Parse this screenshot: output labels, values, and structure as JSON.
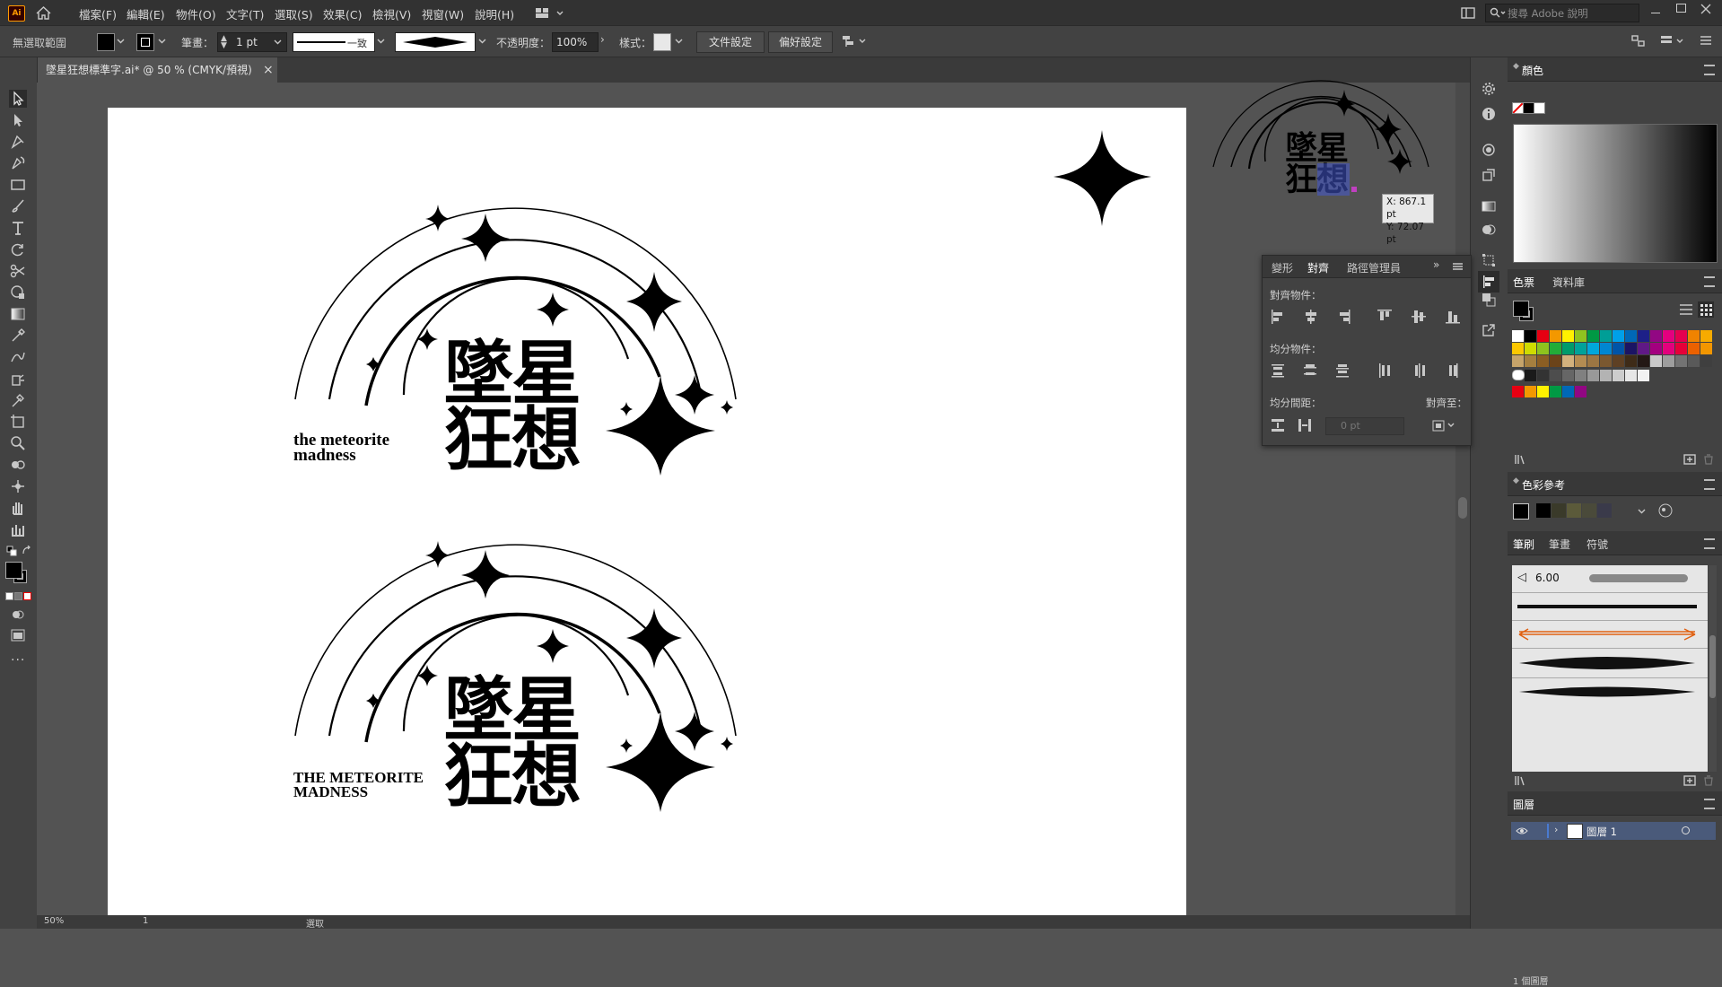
{
  "app": {
    "logo": "Ai"
  },
  "menubar": {
    "items": [
      "檔案(F)",
      "編輯(E)",
      "物件(O)",
      "文字(T)",
      "選取(S)",
      "效果(C)",
      "檢視(V)",
      "視窗(W)",
      "說明(H)"
    ],
    "search_placeholder": "搜尋 Adobe 說明"
  },
  "controlbar": {
    "selection_label": "無選取範圍",
    "stroke_label": "筆畫：",
    "stroke_value": "1 pt",
    "profile_label": "一致",
    "opacity_label": "不透明度：",
    "opacity_value": "100%",
    "style_label": "樣式：",
    "doc_setup": "文件設定",
    "preferences": "偏好設定"
  },
  "document": {
    "tab_title": "墜星狂想標準字.ai* @ 50 % (CMYK/預視)",
    "close": "×"
  },
  "artwork": {
    "logo1_cjk_line1": "墜星",
    "logo1_cjk_line2": "狂想",
    "logo1_en_line1": "the meteorite",
    "logo1_en_line2": "madness",
    "logo2_cjk_line1": "墜星",
    "logo2_cjk_line2": "狂想",
    "logo2_en_line1": "THE METEORITE",
    "logo2_en_line2": "MADNESS",
    "preview_line1": "墜星",
    "preview_line2": "狂想"
  },
  "tooltip": {
    "x": "X: 867.1 pt",
    "y": "Y: 72.07 pt"
  },
  "align_panel": {
    "tabs": [
      "變形",
      "對齊",
      "路徑管理員"
    ],
    "active_tab": "對齊",
    "align_objects": "對齊物件：",
    "distribute_objects": "均分物件：",
    "distribute_spacing": "均分間距：",
    "align_to": "對齊至：",
    "spacing_value": "0 pt"
  },
  "panels": {
    "color": {
      "title": "顏色"
    },
    "swatches": {
      "tabs": [
        "色票",
        "資料庫"
      ]
    },
    "color_guide": {
      "title": "色彩參考"
    },
    "brushes": {
      "tabs": [
        "筆刷",
        "筆畫",
        "符號"
      ],
      "size": "6.00"
    },
    "layers": {
      "title": "圖層",
      "layer_name": "圖層 1",
      "count": "1 個圖層"
    }
  },
  "status": {
    "zoom": "50%",
    "artboard": "1",
    "mode": "選取"
  },
  "colors": {
    "swatch_row1": [
      "#ffffff",
      "#000000",
      "#e60012",
      "#f39800",
      "#fff100",
      "#8fc31f",
      "#009944",
      "#009e96",
      "#00a0e9",
      "#0068b7",
      "#1d2088",
      "#920783",
      "#e4007f",
      "#e5004f",
      "#f08300",
      "#f6ab00"
    ],
    "swatch_row2": [
      "#fcc800",
      "#cfdb00",
      "#8ec31e",
      "#22ac38",
      "#009b6b",
      "#00a29a",
      "#00a7db",
      "#0086d1",
      "#0054a7",
      "#1b1464",
      "#601986",
      "#a3007f",
      "#e3007d",
      "#e60039",
      "#eb6100",
      "#f29600"
    ],
    "swatch_row3": [
      "#c6a46a",
      "#a57f3f",
      "#8b5e23",
      "#6b4319",
      "#d3b17d",
      "#b48c52",
      "#9c7643",
      "#7a5830",
      "#5e4024",
      "#3e2b18",
      "#231815",
      "#c9c9c9",
      "#9e9e9e",
      "#737373",
      "#595959",
      "#3f3f3f"
    ],
    "swatch_gray": [
      "#1a1a1a",
      "#333333",
      "#4d4d4d",
      "#666666",
      "#808080",
      "#999999",
      "#b3b3b3",
      "#cccccc",
      "#e6e6e6",
      "#f2f2f2"
    ],
    "swatch_last": [
      "#e60012",
      "#f39800",
      "#fff100",
      "#009944",
      "#0068b7",
      "#920783"
    ],
    "guide": [
      "#000000",
      "#3a3a2a",
      "#5b5a3a",
      "#4a4a3a",
      "#3a3a4a"
    ]
  }
}
